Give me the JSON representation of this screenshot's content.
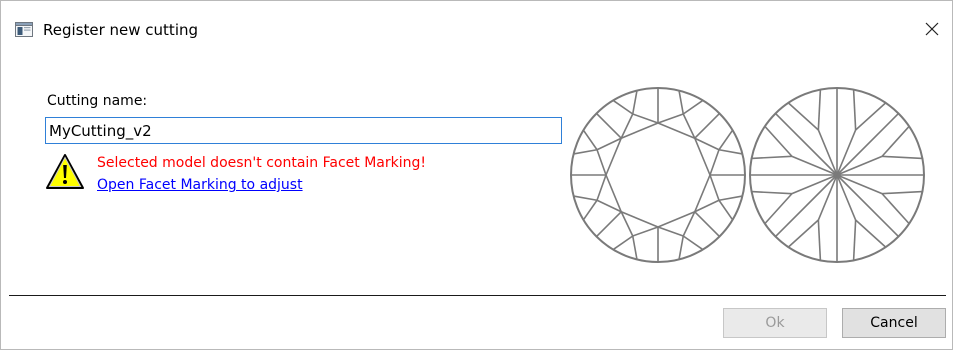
{
  "window": {
    "title": "Register new cutting",
    "app_icon": "window-app-icon",
    "close_icon": "close-icon"
  },
  "form": {
    "name_label": "Cutting name:",
    "name_value": "MyCutting_v2",
    "warning_icon": "warning-icon",
    "error_message": "Selected model doesn't contain Facet Marking!",
    "link_text": "Open Facet Marking to adjust"
  },
  "diagrams": {
    "crown": "crown-diagram",
    "pavilion": "pavilion-diagram"
  },
  "buttons": {
    "ok_label": "Ok",
    "ok_enabled": false,
    "cancel_label": "Cancel"
  },
  "colors": {
    "error": "#ff0000",
    "link": "#0000ff",
    "input_focus_border": "#2f80d8",
    "diagram_stroke": "#7a7a7a",
    "warning_fill": "#ffff00"
  }
}
